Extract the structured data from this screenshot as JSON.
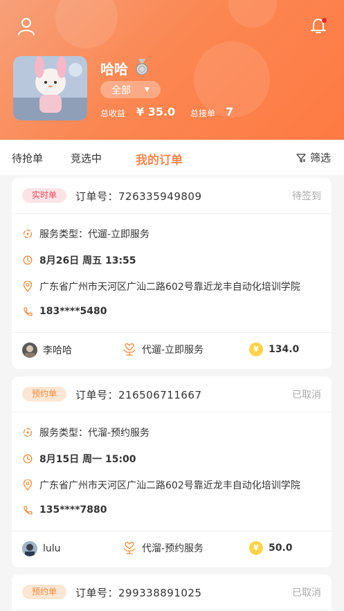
{
  "header": {
    "nickname": "哈哈",
    "filter_label": "全部",
    "income_label": "总收益",
    "income_value": "¥ 35.0",
    "orders_label": "总接单",
    "orders_value": "7"
  },
  "tabs": [
    {
      "label": "待抢单"
    },
    {
      "label": "竞选中"
    },
    {
      "label": "我的订单"
    }
  ],
  "filter_label": "筛选",
  "orders": [
    {
      "badge": "实时单",
      "order_no": "订单号：726335949809",
      "status": "待签到",
      "service_type": "服务类型：代遛-立即服务",
      "time": "8月26日 周五 13:55",
      "address": "广东省广州市天河区广汕二路602号靠近龙丰自动化培训学院",
      "phone": "183****5480",
      "customer": "李哈哈",
      "service": "代遛-立即服务",
      "price": "134.0"
    },
    {
      "badge": "预约单",
      "order_no": "订单号：216506711667",
      "status": "已取消",
      "service_type": "服务类型：代溜-预约服务",
      "time": "8月15日 周一 15:00",
      "address": "广东省广州市天河区广汕二路602号靠近龙丰自动化培训学院",
      "phone": "135****7880",
      "customer": "lulu",
      "service": "代溜-预约服务",
      "price": "50.0"
    },
    {
      "badge": "预约单",
      "order_no": "订单号：299338891025",
      "status": "已取消"
    }
  ],
  "icons": {
    "user": "user-icon",
    "bell": "bell-icon",
    "medal": "medal-icon",
    "filter": "filter-icon",
    "service": "service-type-icon",
    "clock": "clock-icon",
    "location": "location-icon",
    "phone": "phone-icon",
    "heart_hand": "service-heart-icon",
    "coin": "coin-icon"
  },
  "colors": {
    "accent": "#fb8752",
    "live_badge": "#f0475c",
    "book_badge": "#f08a3a",
    "coin": "#fcd34d"
  },
  "coin_symbol": "¥"
}
